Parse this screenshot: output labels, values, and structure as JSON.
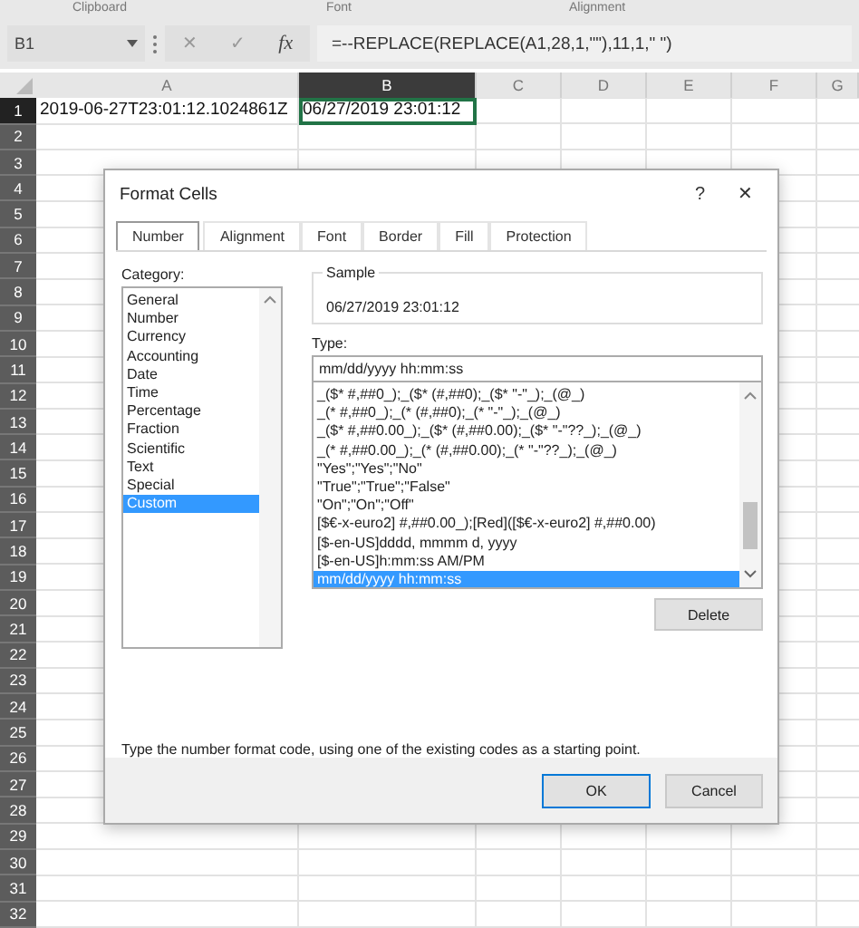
{
  "ribbon_groups": [
    "Clipboard",
    "Font",
    "Alignment"
  ],
  "formula_bar": {
    "name_box": "B1",
    "cancel": "✕",
    "enter": "✓",
    "function": "fx",
    "formula": "=--REPLACE(REPLACE(A1,28,1,\"\"),11,1,\" \")"
  },
  "columns": [
    {
      "label": "A",
      "selected": false
    },
    {
      "label": "B",
      "selected": true
    },
    {
      "label": "C",
      "selected": false
    },
    {
      "label": "D",
      "selected": false
    },
    {
      "label": "E",
      "selected": false
    },
    {
      "label": "F",
      "selected": false
    },
    {
      "label": "G",
      "selected": false
    }
  ],
  "rows": [
    {
      "label": "1",
      "selected": true,
      "cells": [
        "2019-06-27T23:01:12.1024861Z",
        "06/27/2019 23:01:12"
      ]
    },
    {
      "label": "2",
      "selected": false
    },
    {
      "label": "3",
      "selected": false
    },
    {
      "label": "4",
      "selected": false
    },
    {
      "label": "5",
      "selected": false
    },
    {
      "label": "6",
      "selected": false
    },
    {
      "label": "7",
      "selected": false
    },
    {
      "label": "8",
      "selected": false
    },
    {
      "label": "9",
      "selected": false
    },
    {
      "label": "10",
      "selected": false
    },
    {
      "label": "11",
      "selected": false
    },
    {
      "label": "12",
      "selected": false
    },
    {
      "label": "13",
      "selected": false
    },
    {
      "label": "14",
      "selected": false
    },
    {
      "label": "15",
      "selected": false
    },
    {
      "label": "16",
      "selected": false
    },
    {
      "label": "17",
      "selected": false
    },
    {
      "label": "18",
      "selected": false
    },
    {
      "label": "19",
      "selected": false
    },
    {
      "label": "20",
      "selected": false
    },
    {
      "label": "21",
      "selected": false
    },
    {
      "label": "22",
      "selected": false
    },
    {
      "label": "23",
      "selected": false
    },
    {
      "label": "24",
      "selected": false
    },
    {
      "label": "25",
      "selected": false
    },
    {
      "label": "26",
      "selected": false
    },
    {
      "label": "27",
      "selected": false
    },
    {
      "label": "28",
      "selected": false
    },
    {
      "label": "29",
      "selected": false
    },
    {
      "label": "30",
      "selected": false
    },
    {
      "label": "31",
      "selected": false
    },
    {
      "label": "32",
      "selected": false
    }
  ],
  "dialog": {
    "title": "Format Cells",
    "help": "?",
    "close": "✕",
    "tabs": [
      {
        "label": "Number",
        "selected": true
      },
      {
        "label": "Alignment",
        "selected": false
      },
      {
        "label": "Font",
        "selected": false
      },
      {
        "label": "Border",
        "selected": false
      },
      {
        "label": "Fill",
        "selected": false
      },
      {
        "label": "Protection",
        "selected": false
      }
    ],
    "category_label": "Category:",
    "categories": [
      {
        "label": "General",
        "selected": false
      },
      {
        "label": "Number",
        "selected": false
      },
      {
        "label": "Currency",
        "selected": false
      },
      {
        "label": "Accounting",
        "selected": false
      },
      {
        "label": "Date",
        "selected": false
      },
      {
        "label": "Time",
        "selected": false
      },
      {
        "label": "Percentage",
        "selected": false
      },
      {
        "label": "Fraction",
        "selected": false
      },
      {
        "label": "Scientific",
        "selected": false
      },
      {
        "label": "Text",
        "selected": false
      },
      {
        "label": "Special",
        "selected": false
      },
      {
        "label": "Custom",
        "selected": true
      }
    ],
    "sample_label": "Sample",
    "sample": "06/27/2019 23:01:12",
    "type_label": "Type:",
    "type_value": "mm/dd/yyyy hh:mm:ss",
    "types": [
      {
        "label": "_($* #,##0_);_($* (#,##0);_($* \"-\"_);_(@_)",
        "selected": false
      },
      {
        "label": "_(* #,##0_);_(* (#,##0);_(* \"-\"_);_(@_)",
        "selected": false
      },
      {
        "label": "_($* #,##0.00_);_($* (#,##0.00);_($* \"-\"??_);_(@_)",
        "selected": false
      },
      {
        "label": "_(* #,##0.00_);_(* (#,##0.00);_(* \"-\"??_);_(@_)",
        "selected": false
      },
      {
        "label": "\"Yes\";\"Yes\";\"No\"",
        "selected": false
      },
      {
        "label": "\"True\";\"True\";\"False\"",
        "selected": false
      },
      {
        "label": "\"On\";\"On\";\"Off\"",
        "selected": false
      },
      {
        "label": "[$€-x-euro2] #,##0.00_);[Red]([$€-x-euro2] #,##0.00)",
        "selected": false
      },
      {
        "label": "[$-en-US]dddd, mmmm d, yyyy",
        "selected": false
      },
      {
        "label": "[$-en-US]h:mm:ss AM/PM",
        "selected": false
      },
      {
        "label": "mm/dd/yyyy hh:mm:ss",
        "selected": true
      }
    ],
    "delete": "Delete",
    "description": "Type the number format code, using one of the existing codes as a starting point.",
    "ok": "OK",
    "cancel": "Cancel"
  }
}
